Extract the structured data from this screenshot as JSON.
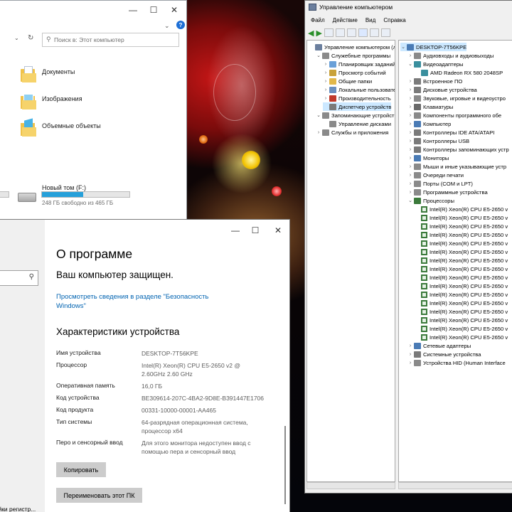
{
  "explorer": {
    "search_placeholder": "Поиск в: Этот компьютер",
    "folders": [
      {
        "label": "Документы",
        "icon": "documents-folder-icon"
      },
      {
        "label": "Изображения",
        "icon": "pictures-folder-icon"
      },
      {
        "label": "Объемные объекты",
        "icon": "3d-objects-folder-icon"
      }
    ],
    "drive": {
      "label": "Новый том (F:)",
      "free_text": "248 ГБ свободно из 465 ГБ",
      "used_fraction": 0.47
    }
  },
  "about": {
    "title": "О программе",
    "protected_text": "Ваш компьютер защищен.",
    "security_link": "Просмотреть сведения в разделе \"Безопасность Windows\"",
    "specs_heading": "Характеристики устройства",
    "specs": [
      {
        "label": "Имя устройства",
        "value": "DESKTOP-7T56KPE"
      },
      {
        "label": "Процессор",
        "value": "Intel(R) Xeon(R) CPU E5-2650 v2 @ 2.60GHz   2.60 GHz"
      },
      {
        "label": "Оперативная память",
        "value": "16,0 ГБ"
      },
      {
        "label": "Код устройства",
        "value": "BE309614-207C-4BA2-9D8E-B391447E1706"
      },
      {
        "label": "Код продукта",
        "value": "00331-10000-00001-AA465"
      },
      {
        "label": "Тип системы",
        "value": "64-разрядная операционная система, процессор x64"
      },
      {
        "label": "Перо и сенсорный ввод",
        "value": "Для этого монитора недоступен ввод с помощью пера и сенсорный ввод"
      }
    ],
    "copy_button": "Копировать",
    "rename_button": "Переименовать этот ПК",
    "bottom_left_text": "Настройки регистр..."
  },
  "mgmt": {
    "title": "Управление компьютером",
    "menu": [
      "Файл",
      "Действие",
      "Вид",
      "Справка"
    ],
    "left_tree": [
      {
        "label": "Управление компьютером (л",
        "indent": 0,
        "twisty": "",
        "icon": "computer-management-icon",
        "color": "#6b7f9e"
      },
      {
        "label": "Служебные программы",
        "indent": 1,
        "twisty": "⌄",
        "icon": "tools-icon",
        "color": "#8a8a8a"
      },
      {
        "label": "Планировщик заданий",
        "indent": 2,
        "twisty": "›",
        "icon": "task-scheduler-icon",
        "color": "#6aa0d8"
      },
      {
        "label": "Просмотр событий",
        "indent": 2,
        "twisty": "›",
        "icon": "event-viewer-icon",
        "color": "#c9a23a"
      },
      {
        "label": "Общие папки",
        "indent": 2,
        "twisty": "›",
        "icon": "shared-folders-icon",
        "color": "#e2b84a"
      },
      {
        "label": "Локальные пользовате",
        "indent": 2,
        "twisty": "›",
        "icon": "local-users-icon",
        "color": "#6a8fbf"
      },
      {
        "label": "Производительность",
        "indent": 2,
        "twisty": "›",
        "icon": "performance-icon",
        "color": "#c0392b"
      },
      {
        "label": "Диспетчер устройств",
        "indent": 2,
        "twisty": "",
        "icon": "device-manager-icon",
        "color": "#7a7a7a",
        "selected": true
      },
      {
        "label": "Запоминающие устройст",
        "indent": 1,
        "twisty": "⌄",
        "icon": "storage-icon",
        "color": "#8a8a8a"
      },
      {
        "label": "Управление дисками",
        "indent": 2,
        "twisty": "",
        "icon": "disk-management-icon",
        "color": "#8a8a8a"
      },
      {
        "label": "Службы и приложения",
        "indent": 1,
        "twisty": "›",
        "icon": "services-icon",
        "color": "#8a8a8a"
      }
    ],
    "right_tree": [
      {
        "label": "DESKTOP-7T56KPE",
        "indent": 0,
        "twisty": "⌄",
        "icon": "computer-icon",
        "color": "#4a7bb5",
        "selected": true
      },
      {
        "label": "Аудиовходы и аудиовыходы",
        "indent": 1,
        "twisty": "›",
        "icon": "audio-icon",
        "color": "#8a8a8a"
      },
      {
        "label": "Видеоадаптеры",
        "indent": 1,
        "twisty": "⌄",
        "icon": "display-adapter-icon",
        "color": "#3a8f9e"
      },
      {
        "label": "AMD Radeon RX 580 2048SP",
        "indent": 2,
        "twisty": "",
        "icon": "gpu-icon",
        "color": "#3a8f9e"
      },
      {
        "label": "Встроенное ПО",
        "indent": 1,
        "twisty": "›",
        "icon": "firmware-icon",
        "color": "#7a7a7a"
      },
      {
        "label": "Дисковые устройства",
        "indent": 1,
        "twisty": "›",
        "icon": "disk-drives-icon",
        "color": "#7a7a7a"
      },
      {
        "label": "Звуковые, игровые и видеоустро",
        "indent": 1,
        "twisty": "›",
        "icon": "sound-icon",
        "color": "#8a8a8a"
      },
      {
        "label": "Клавиатуры",
        "indent": 1,
        "twisty": "›",
        "icon": "keyboard-icon",
        "color": "#6a6a6a"
      },
      {
        "label": "Компоненты программного обе",
        "indent": 1,
        "twisty": "›",
        "icon": "software-components-icon",
        "color": "#8a8a8a"
      },
      {
        "label": "Компьютер",
        "indent": 1,
        "twisty": "›",
        "icon": "computer-icon",
        "color": "#4a7bb5"
      },
      {
        "label": "Контроллеры IDE ATA/ATAPI",
        "indent": 1,
        "twisty": "›",
        "icon": "ide-controller-icon",
        "color": "#7a7a7a"
      },
      {
        "label": "Контроллеры USB",
        "indent": 1,
        "twisty": "›",
        "icon": "usb-icon",
        "color": "#7a7a7a"
      },
      {
        "label": "Контроллеры запоминающих устр",
        "indent": 1,
        "twisty": "›",
        "icon": "storage-controller-icon",
        "color": "#7a7a7a"
      },
      {
        "label": "Мониторы",
        "indent": 1,
        "twisty": "›",
        "icon": "monitor-icon",
        "color": "#4a7bb5"
      },
      {
        "label": "Мыши и иные указывающие устр",
        "indent": 1,
        "twisty": "›",
        "icon": "mouse-icon",
        "color": "#8a8a8a"
      },
      {
        "label": "Очереди печати",
        "indent": 1,
        "twisty": "›",
        "icon": "print-queue-icon",
        "color": "#8a8a8a"
      },
      {
        "label": "Порты (COM и LPT)",
        "indent": 1,
        "twisty": "›",
        "icon": "ports-icon",
        "color": "#8a8a8a"
      },
      {
        "label": "Программные устройства",
        "indent": 1,
        "twisty": "›",
        "icon": "software-devices-icon",
        "color": "#8a8a8a"
      },
      {
        "label": "Процессоры",
        "indent": 1,
        "twisty": "⌄",
        "icon": "processors-icon",
        "color": "#3b7a3b"
      },
      {
        "label": "Intel(R) Xeon(R) CPU E5-2650 v",
        "indent": 2,
        "twisty": "",
        "icon": "cpu-icon",
        "cpu": true
      },
      {
        "label": "Intel(R) Xeon(R) CPU E5-2650 v",
        "indent": 2,
        "twisty": "",
        "icon": "cpu-icon",
        "cpu": true
      },
      {
        "label": "Intel(R) Xeon(R) CPU E5-2650 v",
        "indent": 2,
        "twisty": "",
        "icon": "cpu-icon",
        "cpu": true
      },
      {
        "label": "Intel(R) Xeon(R) CPU E5-2650 v",
        "indent": 2,
        "twisty": "",
        "icon": "cpu-icon",
        "cpu": true
      },
      {
        "label": "Intel(R) Xeon(R) CPU E5-2650 v",
        "indent": 2,
        "twisty": "",
        "icon": "cpu-icon",
        "cpu": true
      },
      {
        "label": "Intel(R) Xeon(R) CPU E5-2650 v",
        "indent": 2,
        "twisty": "",
        "icon": "cpu-icon",
        "cpu": true
      },
      {
        "label": "Intel(R) Xeon(R) CPU E5-2650 v",
        "indent": 2,
        "twisty": "",
        "icon": "cpu-icon",
        "cpu": true
      },
      {
        "label": "Intel(R) Xeon(R) CPU E5-2650 v",
        "indent": 2,
        "twisty": "",
        "icon": "cpu-icon",
        "cpu": true
      },
      {
        "label": "Intel(R) Xeon(R) CPU E5-2650 v",
        "indent": 2,
        "twisty": "",
        "icon": "cpu-icon",
        "cpu": true
      },
      {
        "label": "Intel(R) Xeon(R) CPU E5-2650 v",
        "indent": 2,
        "twisty": "",
        "icon": "cpu-icon",
        "cpu": true
      },
      {
        "label": "Intel(R) Xeon(R) CPU E5-2650 v",
        "indent": 2,
        "twisty": "",
        "icon": "cpu-icon",
        "cpu": true
      },
      {
        "label": "Intel(R) Xeon(R) CPU E5-2650 v",
        "indent": 2,
        "twisty": "",
        "icon": "cpu-icon",
        "cpu": true
      },
      {
        "label": "Intel(R) Xeon(R) CPU E5-2650 v",
        "indent": 2,
        "twisty": "",
        "icon": "cpu-icon",
        "cpu": true
      },
      {
        "label": "Intel(R) Xeon(R) CPU E5-2650 v",
        "indent": 2,
        "twisty": "",
        "icon": "cpu-icon",
        "cpu": true
      },
      {
        "label": "Intel(R) Xeon(R) CPU E5-2650 v",
        "indent": 2,
        "twisty": "",
        "icon": "cpu-icon",
        "cpu": true
      },
      {
        "label": "Intel(R) Xeon(R) CPU E5-2650 v",
        "indent": 2,
        "twisty": "",
        "icon": "cpu-icon",
        "cpu": true
      },
      {
        "label": "Сетевые адаптеры",
        "indent": 1,
        "twisty": "›",
        "icon": "network-adapter-icon",
        "color": "#4a7bb5"
      },
      {
        "label": "Системные устройства",
        "indent": 1,
        "twisty": "›",
        "icon": "system-devices-icon",
        "color": "#7a7a7a"
      },
      {
        "label": "Устройства HID (Human Interface",
        "indent": 1,
        "twisty": "›",
        "icon": "hid-icon",
        "color": "#8a8a8a"
      }
    ]
  },
  "colors": {
    "accent_link": "#0063b1",
    "drive_fill": "#26a0da",
    "selection": "#cce8ff"
  }
}
